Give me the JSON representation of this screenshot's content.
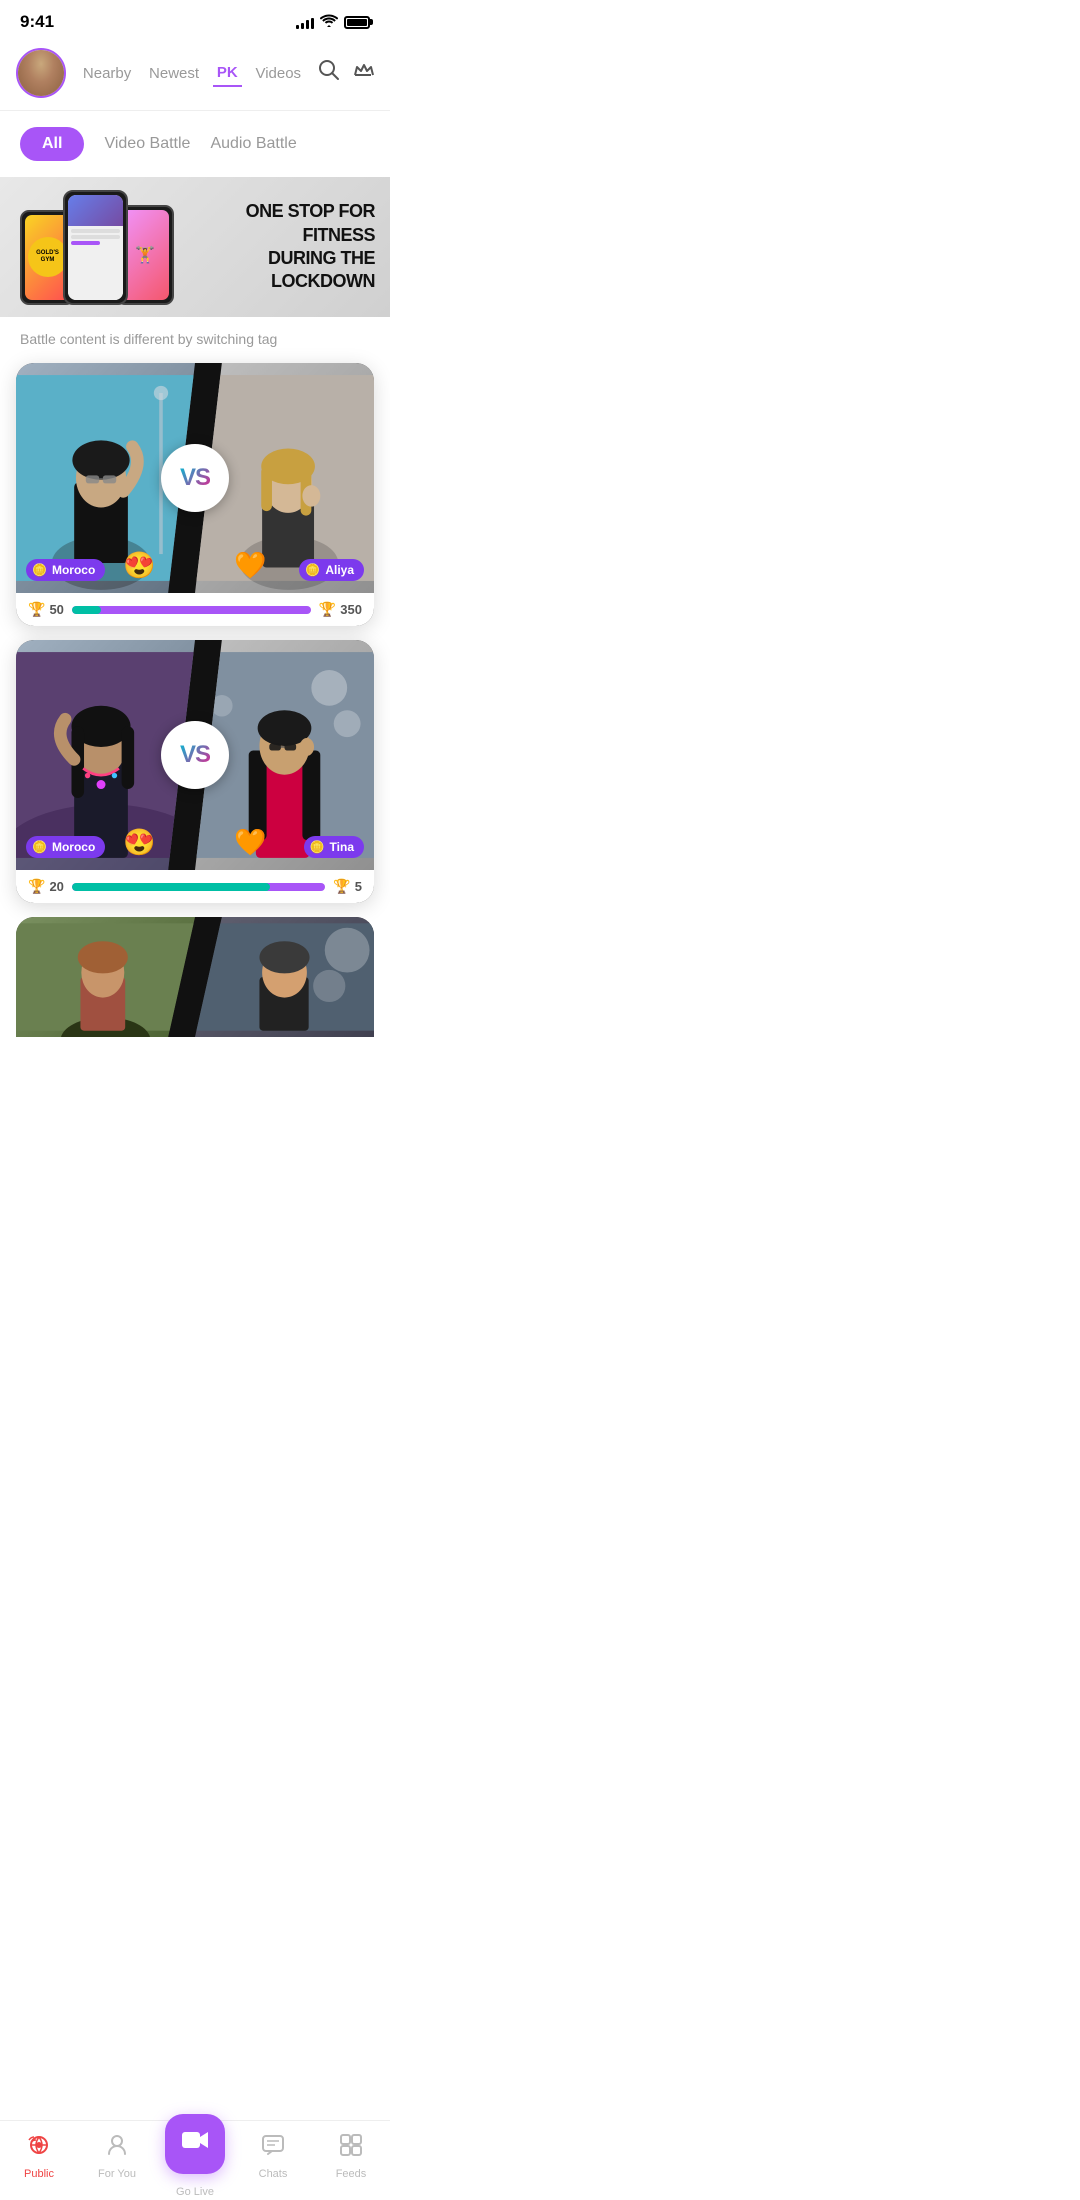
{
  "status": {
    "time": "9:41",
    "signal": [
      4,
      6,
      8,
      10,
      12
    ],
    "battery_pct": 90
  },
  "header": {
    "nav_items": [
      "Nearby",
      "Newest",
      "PK",
      "Videos"
    ],
    "active_nav": "PK"
  },
  "filter": {
    "tabs": [
      "All",
      "Video Battle",
      "Audio Battle"
    ],
    "active_tab": "All"
  },
  "banner": {
    "text_line1": "ONE STOP FOR FITNESS",
    "text_line2": "DURING THE LOCKDOWN",
    "gym_label": "GOLD'S GYM"
  },
  "tag_hint": "Battle content is different by switching tag",
  "battles": [
    {
      "id": 1,
      "left_user": "Moroco",
      "right_user": "Aliya",
      "left_score": 50,
      "right_score": 350,
      "left_emoji": "😍",
      "right_emoji": "🧡",
      "progress_pct": 12
    },
    {
      "id": 2,
      "left_user": "Moroco",
      "right_user": "Tina",
      "left_score": 20,
      "right_score": 5,
      "left_emoji": "😍",
      "right_emoji": "🧡",
      "progress_pct": 78
    }
  ],
  "bottom_nav": {
    "items": [
      {
        "id": "public",
        "label": "Public",
        "icon": "📡",
        "active": true
      },
      {
        "id": "for_you",
        "label": "For You",
        "icon": "👤",
        "active": false
      },
      {
        "id": "go_live",
        "label": "Go Live",
        "icon": "🎥",
        "active": false,
        "center": true
      },
      {
        "id": "chats",
        "label": "Chats",
        "icon": "💬",
        "active": false
      },
      {
        "id": "feeds",
        "label": "Feeds",
        "icon": "📋",
        "active": false
      }
    ]
  },
  "vs_label": "VS"
}
